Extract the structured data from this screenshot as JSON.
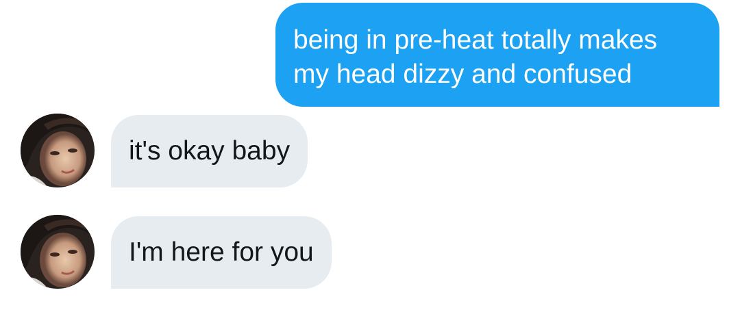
{
  "messages": [
    {
      "direction": "outgoing",
      "text": "being in pre-heat totally makes\nmy head dizzy and confused"
    },
    {
      "direction": "incoming",
      "text": "it's okay baby"
    },
    {
      "direction": "incoming",
      "text": "I'm here for you"
    }
  ],
  "colors": {
    "outgoing_bubble": "#1da1f2",
    "incoming_bubble": "#e7ecf0",
    "outgoing_text": "#ffffff",
    "incoming_text": "#14171a"
  },
  "icons": {
    "avatar": "contact-avatar-photo"
  }
}
